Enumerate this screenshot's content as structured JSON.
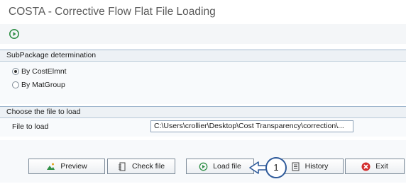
{
  "window": {
    "title": "COSTA - Corrective Flow Flat File Loading"
  },
  "toolbar": {
    "execute_icon": "execute-icon"
  },
  "subpackage": {
    "header": "SubPackage determination",
    "options": [
      {
        "label": "By CostElmnt",
        "selected": true
      },
      {
        "label": "By MatGroup",
        "selected": false
      }
    ]
  },
  "file_group": {
    "header": "Choose the file to load",
    "label": "File to load",
    "value": "C:\\Users\\crollier\\Desktop\\Cost Transparency\\correction\\..."
  },
  "buttons": {
    "preview": "Preview",
    "check_file": "Check file",
    "load_file": "Load file",
    "history": "History",
    "exit": "Exit"
  },
  "callout": {
    "number": "1"
  },
  "colors": {
    "accent": "#2e5a9a",
    "exit_red": "#d32f2f",
    "exec_green": "#2f8f46"
  }
}
